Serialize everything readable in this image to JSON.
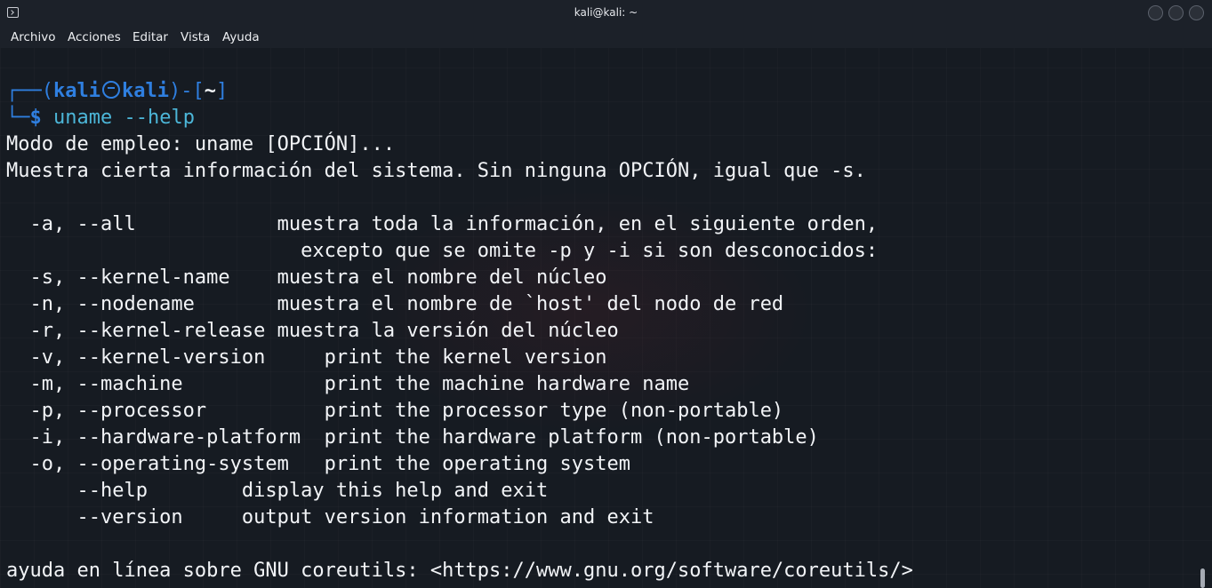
{
  "window": {
    "title": "kali@kali: ~"
  },
  "menu": [
    "Archivo",
    "Acciones",
    "Editar",
    "Vista",
    "Ayuda"
  ],
  "prompt": {
    "top_prefix": "┌──(",
    "user": "kali",
    "host": "kali",
    "mid": ")-[",
    "path": "~",
    "close": "]",
    "bottom_prefix": "└─",
    "symbol": "$",
    "command": " uname --help"
  },
  "output": [
    "Modo de empleo: uname [OPCIÓN]...",
    "Muestra cierta información del sistema. Sin ninguna OPCIÓN, igual que -s.",
    "",
    "  -a, --all            muestra toda la información, en el siguiente orden,",
    "                         excepto que se omite -p y -i si son desconocidos:",
    "  -s, --kernel-name    muestra el nombre del núcleo",
    "  -n, --nodename       muestra el nombre de `host' del nodo de red",
    "  -r, --kernel-release muestra la versión del núcleo",
    "  -v, --kernel-version     print the kernel version",
    "  -m, --machine            print the machine hardware name",
    "  -p, --processor          print the processor type (non-portable)",
    "  -i, --hardware-platform  print the hardware platform (non-portable)",
    "  -o, --operating-system   print the operating system",
    "      --help        display this help and exit",
    "      --version     output version information and exit",
    "",
    "ayuda en línea sobre GNU coreutils: <https://www.gnu.org/software/coreutils/>"
  ],
  "colors": {
    "background": "#161b22",
    "prompt": "#2f7fe0",
    "command": "#4cb6d8",
    "text": "#f2f4f7"
  },
  "icons": {
    "app": "terminal-icon",
    "prompt": "kali-skull-icon"
  }
}
